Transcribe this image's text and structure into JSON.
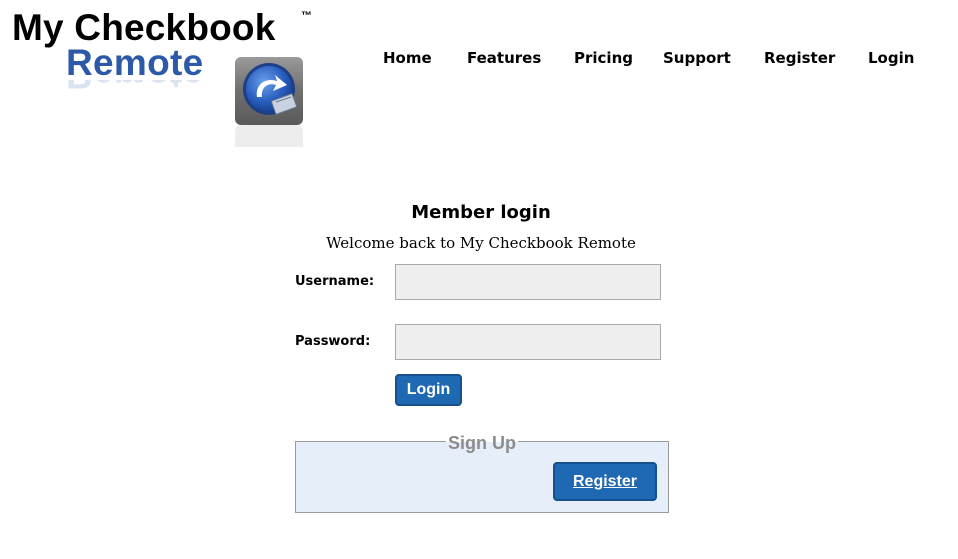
{
  "logo": {
    "title": "My Checkbook",
    "trademark": "™",
    "subtitle": "Remote",
    "icon": "app-arrow-icon"
  },
  "nav": {
    "items": [
      {
        "label": "Home"
      },
      {
        "label": "Features"
      },
      {
        "label": "Pricing"
      },
      {
        "label": "Support"
      },
      {
        "label": "Register"
      },
      {
        "label": "Login"
      }
    ]
  },
  "login": {
    "heading": "Member login",
    "welcome": "Welcome back to My Checkbook Remote",
    "username_label": "Username:",
    "username_value": "",
    "password_label": "Password:",
    "password_value": "",
    "submit_label": "Login"
  },
  "signup": {
    "legend": "Sign Up",
    "register_label": "Register"
  },
  "colors": {
    "brand_blue": "#2d5aa8",
    "button_blue": "#1f68b2",
    "field_bg": "#eeeeee",
    "signup_bg": "#e6eef9"
  }
}
